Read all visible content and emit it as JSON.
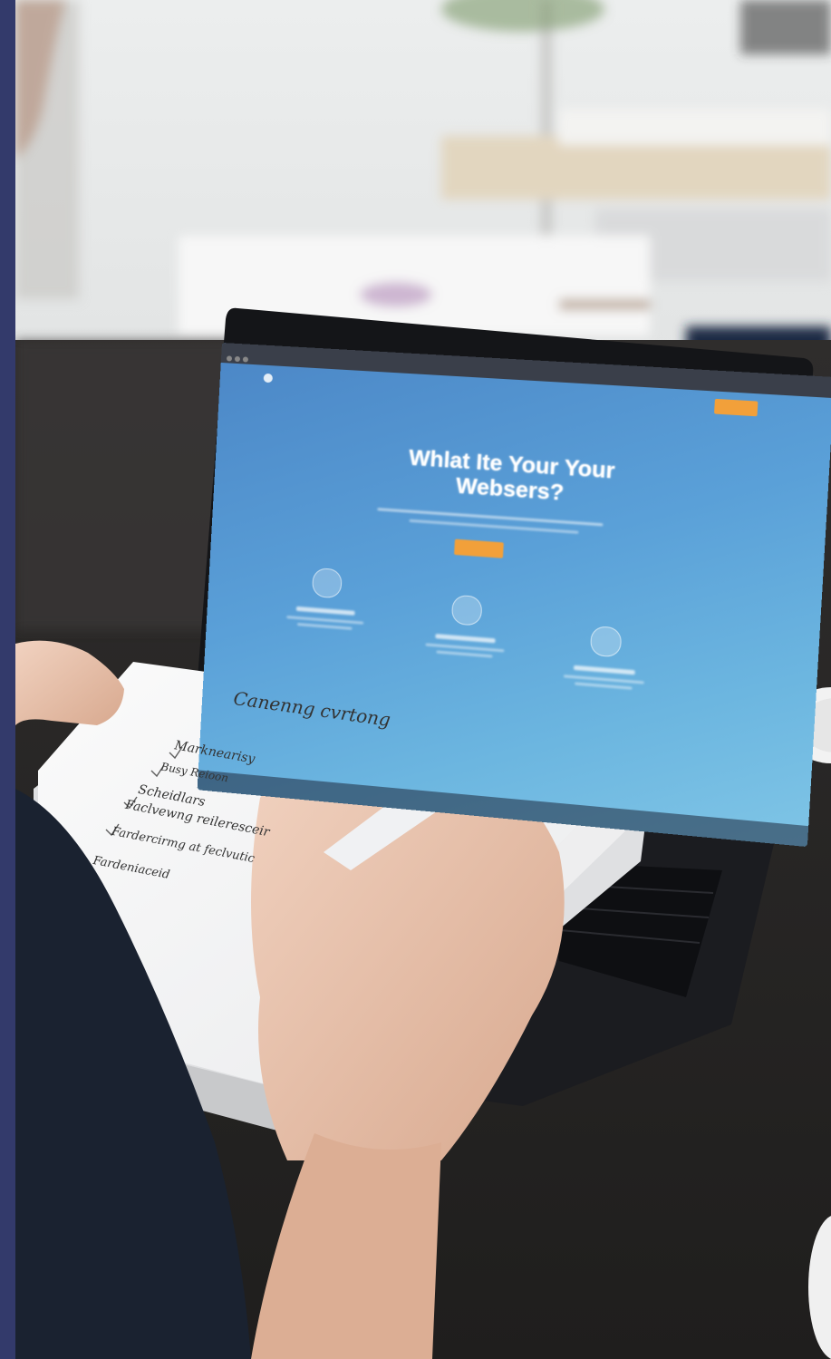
{
  "laptop_screen": {
    "hero_title": "Whlat Ite Your Your Websers?"
  },
  "notebook": {
    "heading": "Canenng cvrtong",
    "lines": [
      "Marknearisy",
      "Busy Reioon",
      "Scheidlars",
      "Faclvewng reileresceir",
      "Fardercirmg at feclvutic",
      "Fardeniaceid"
    ]
  },
  "colors": {
    "side_bar": "#333a6b",
    "screen_gradient_start": "#4b86c6",
    "screen_gradient_end": "#7fc5e6",
    "accent_button": "#f2a03a"
  }
}
